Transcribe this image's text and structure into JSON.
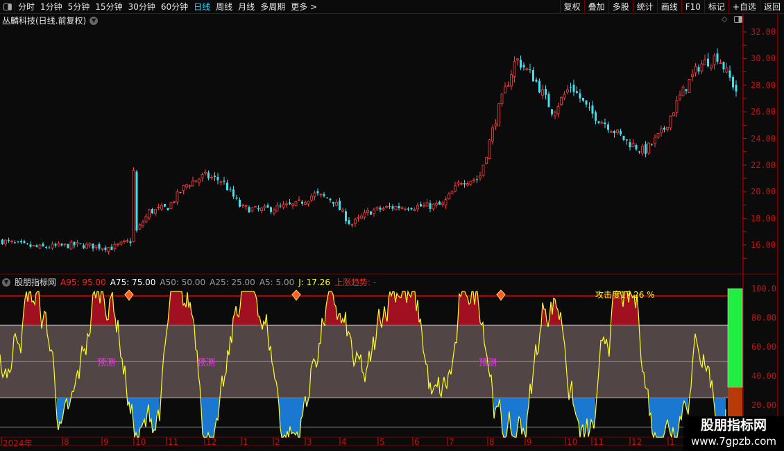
{
  "toolbar": {
    "periods": [
      "分时",
      "1分钟",
      "5分钟",
      "15分钟",
      "30分钟",
      "60分钟",
      "日线",
      "周线",
      "月线",
      "多周期",
      "更多 >"
    ],
    "active": "日线",
    "right_buttons": [
      "复权",
      "叠加",
      "多股",
      "统计",
      "画线",
      "F10",
      "标记",
      "+自选",
      "返回"
    ]
  },
  "main": {
    "title": "丛麟科技(日线.前复权)",
    "price_axis": [
      "32.00",
      "30.00",
      "28.00",
      "26.00",
      "24.00",
      "22.00",
      "20.00",
      "18.00",
      "16.00"
    ],
    "closes": [
      16.3,
      16.0,
      15.8,
      15.9,
      16.0,
      15.9,
      15.8,
      16.3,
      18.5,
      18.8,
      20.5,
      21.2,
      20.8,
      18.8,
      18.6,
      18.8,
      19.0,
      19.8,
      19.4,
      17.5,
      18.5,
      18.8,
      18.9,
      18.9,
      19.0,
      20.8,
      21.0,
      26.0,
      30.0,
      28.5,
      26.0,
      28.0,
      26.0,
      25.0,
      23.8,
      23.0,
      24.5,
      27.3,
      29.5,
      30.2,
      27.6
    ],
    "colors": {
      "up": "#ff3c3c",
      "down": "#40e0f0"
    }
  },
  "indicator": {
    "name": "股朋指标网",
    "params": [
      {
        "label": "A95: 95.00",
        "color": "#ff2020"
      },
      {
        "label": "A75: 75.00",
        "color": "#ffffff"
      },
      {
        "label": "A50: 50.00",
        "color": "#9a9a9a"
      },
      {
        "label": "A25: 25.00",
        "color": "#9a9a9a"
      },
      {
        "label": "A5: 5.00",
        "color": "#9a9a9a"
      },
      {
        "label": "J: 17.26",
        "color": "#ffff30"
      },
      {
        "label": "上涨趋势: -",
        "color": "#ff2020"
      }
    ],
    "attack": "攻击度17.26 %",
    "attack_value": 17.26,
    "forecast_label": "预测",
    "axis": [
      "100.0",
      "80.00",
      "60.00",
      "40.00",
      "20.00"
    ],
    "colors": {
      "line": "#ffff20",
      "high_fill": "#a01020",
      "low_fill": "#1a78d0",
      "band": "#524545",
      "bar_up": "#20ee40",
      "bar_down": "#b83a08"
    }
  },
  "dates": [
    "2024年",
    "8",
    "9",
    "10",
    "11",
    "12",
    "1",
    "2",
    "3",
    "4",
    "5",
    "6",
    "7",
    "8",
    "9",
    "10",
    "11",
    "12",
    "1"
  ],
  "watermark": {
    "name": "股朋指标网",
    "url": "www.7gpzb.com"
  }
}
